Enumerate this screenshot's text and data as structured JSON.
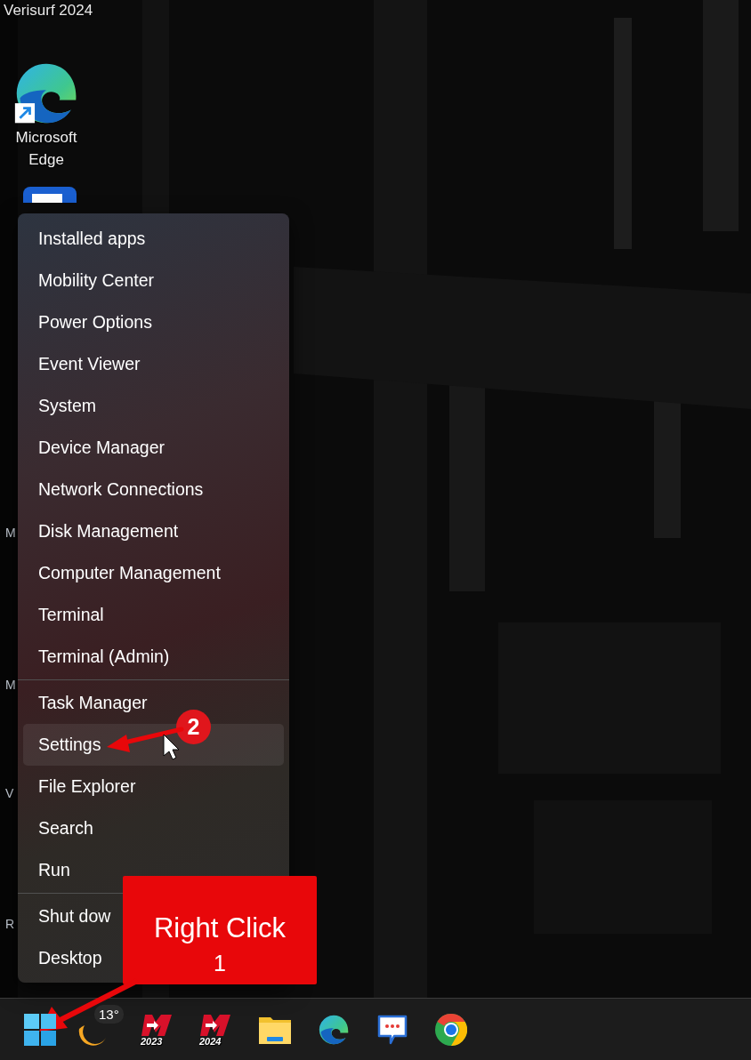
{
  "desktop": {
    "icons": [
      {
        "kind": "text",
        "label": "Verisurf 2024"
      },
      {
        "kind": "edge",
        "label": "Microsoft Edge"
      },
      {
        "kind": "blue-app"
      }
    ],
    "cut_labels": [
      "M",
      "M",
      "V",
      "R"
    ]
  },
  "context_menu": {
    "groups": [
      [
        {
          "label": "Installed apps",
          "selected": false
        },
        {
          "label": "Mobility Center",
          "selected": false
        },
        {
          "label": "Power Options",
          "selected": false
        },
        {
          "label": "Event Viewer",
          "selected": false
        },
        {
          "label": "System",
          "selected": false
        },
        {
          "label": "Device Manager",
          "selected": false
        },
        {
          "label": "Network Connections",
          "selected": false
        },
        {
          "label": "Disk Management",
          "selected": false
        },
        {
          "label": "Computer Management",
          "selected": false
        },
        {
          "label": "Terminal",
          "selected": false
        },
        {
          "label": "Terminal (Admin)",
          "selected": false
        }
      ],
      [
        {
          "label": "Task Manager",
          "selected": false
        },
        {
          "label": "Settings",
          "selected": true
        },
        {
          "label": "File Explorer",
          "selected": false
        },
        {
          "label": "Search",
          "selected": false
        },
        {
          "label": "Run",
          "selected": false
        }
      ],
      [
        {
          "label": "Shut dow",
          "selected": false
        },
        {
          "label": "Desktop",
          "selected": false
        }
      ]
    ]
  },
  "annotations": [
    {
      "kind": "callout",
      "label": "Right Click",
      "number": "1"
    },
    {
      "kind": "badge",
      "number": "2"
    }
  ],
  "taskbar": {
    "items": [
      {
        "kind": "start"
      },
      {
        "kind": "weather",
        "badge": "13°"
      },
      {
        "kind": "app",
        "caption": "2023"
      },
      {
        "kind": "app",
        "caption": "2024"
      },
      {
        "kind": "folder"
      },
      {
        "kind": "edge"
      },
      {
        "kind": "chat"
      },
      {
        "kind": "chrome"
      }
    ]
  }
}
